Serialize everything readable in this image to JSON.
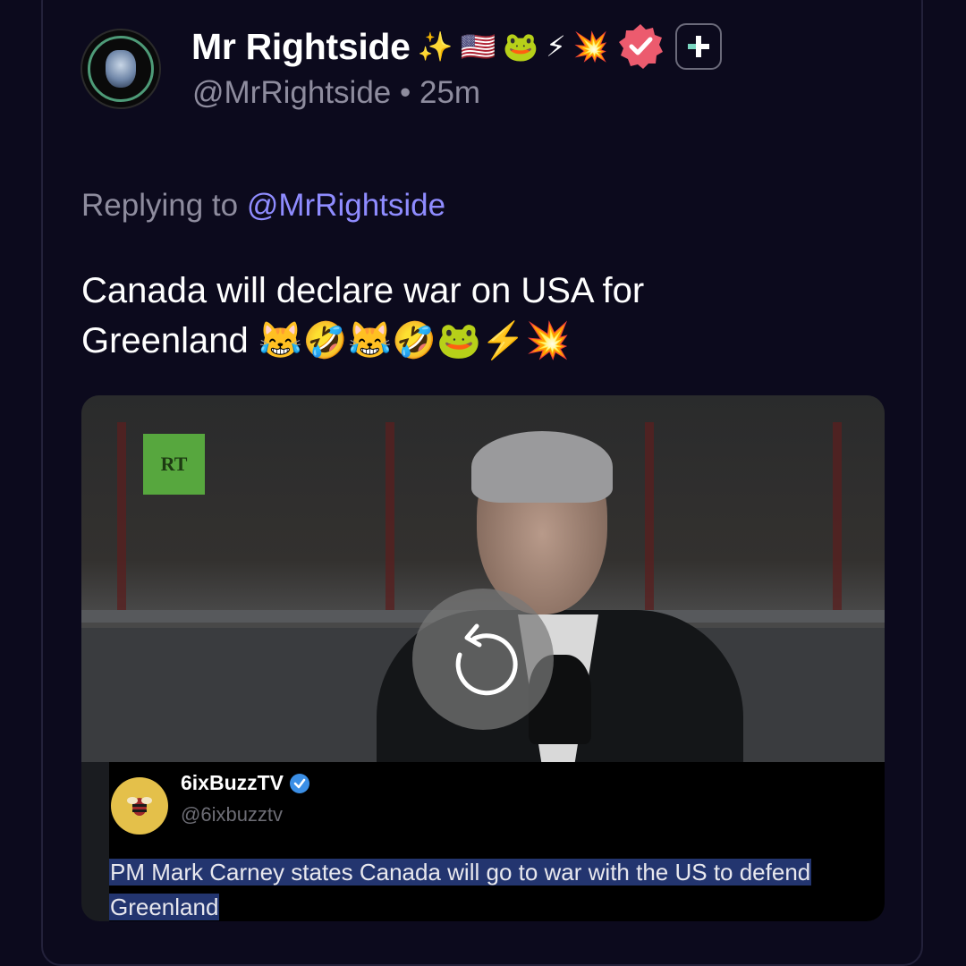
{
  "post": {
    "display_name": "Mr Rightside",
    "name_emojis": [
      "✨",
      "🇺🇸",
      "🐸",
      "⚡",
      "💥"
    ],
    "handle": "@MrRightside",
    "separator": "•",
    "time_ago": "25m",
    "reply_prefix": "Replying to",
    "reply_mention": "@MrRightside",
    "text_line1": "Canada will declare war on USA for",
    "text_line2": "Greenland 😹🤣😹🤣🐸⚡💥"
  },
  "icons": {
    "verified": "verified-badge-icon",
    "follow": "plus-icon",
    "replay": "replay-icon"
  },
  "colors": {
    "background": "#0c0a1d",
    "mention": "#8f8cff",
    "verified_badge": "#ec5b6e",
    "secondary_text": "#8e8c9e"
  },
  "media": {
    "logo_text": "RT",
    "embedded_post": {
      "name": "6ixBuzzTV",
      "handle": "@6ixbuzztv",
      "text_line1": "PM Mark Carney states Canada will go to war with the US to defend",
      "text_line2": "Greenland"
    }
  }
}
